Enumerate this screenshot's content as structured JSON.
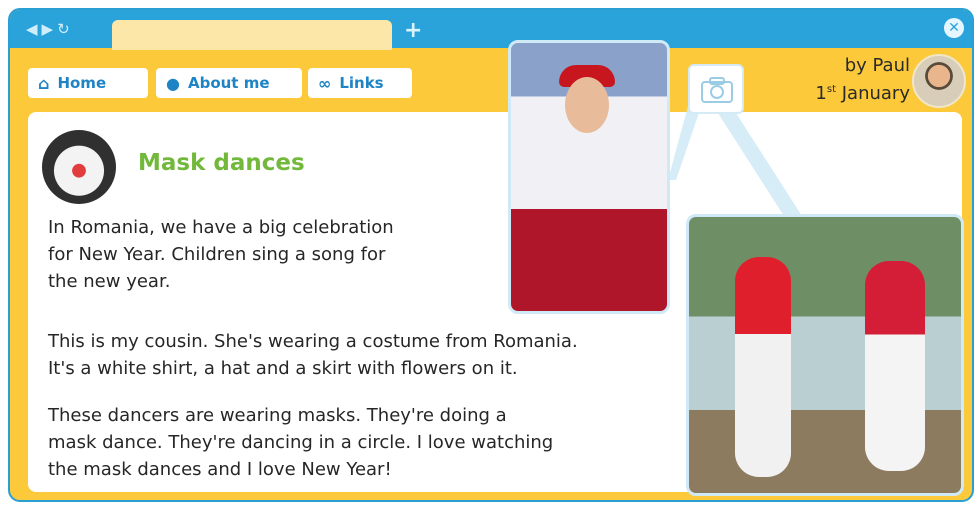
{
  "nav": {
    "buttons": [
      {
        "label": "Home",
        "icon": "home-icon"
      },
      {
        "label": "About me",
        "icon": "person-icon"
      },
      {
        "label": "Links",
        "icon": "link-icon"
      }
    ]
  },
  "post": {
    "author": "by Paul",
    "date_day": "1",
    "date_suffix": "st",
    "date_month": "January",
    "title": "Mask dances",
    "paragraphs": [
      "In Romania, we have a big celebration",
      "for New Year. Children sing a song for",
      "the new year.",
      "This is my cousin. She's wearing a costume from Romania.",
      "It's a white shirt, a hat and a skirt with flowers on it.",
      "These dancers are wearing masks. They're doing a",
      "mask dance. They're dancing in a circle. I love watching",
      "the mask dances and I love New Year!"
    ]
  },
  "colors": {
    "window_frame": "#fbc93a",
    "titlebar": "#2aa3db",
    "nav_text": "#1f84c6",
    "title_green": "#72b83a"
  }
}
